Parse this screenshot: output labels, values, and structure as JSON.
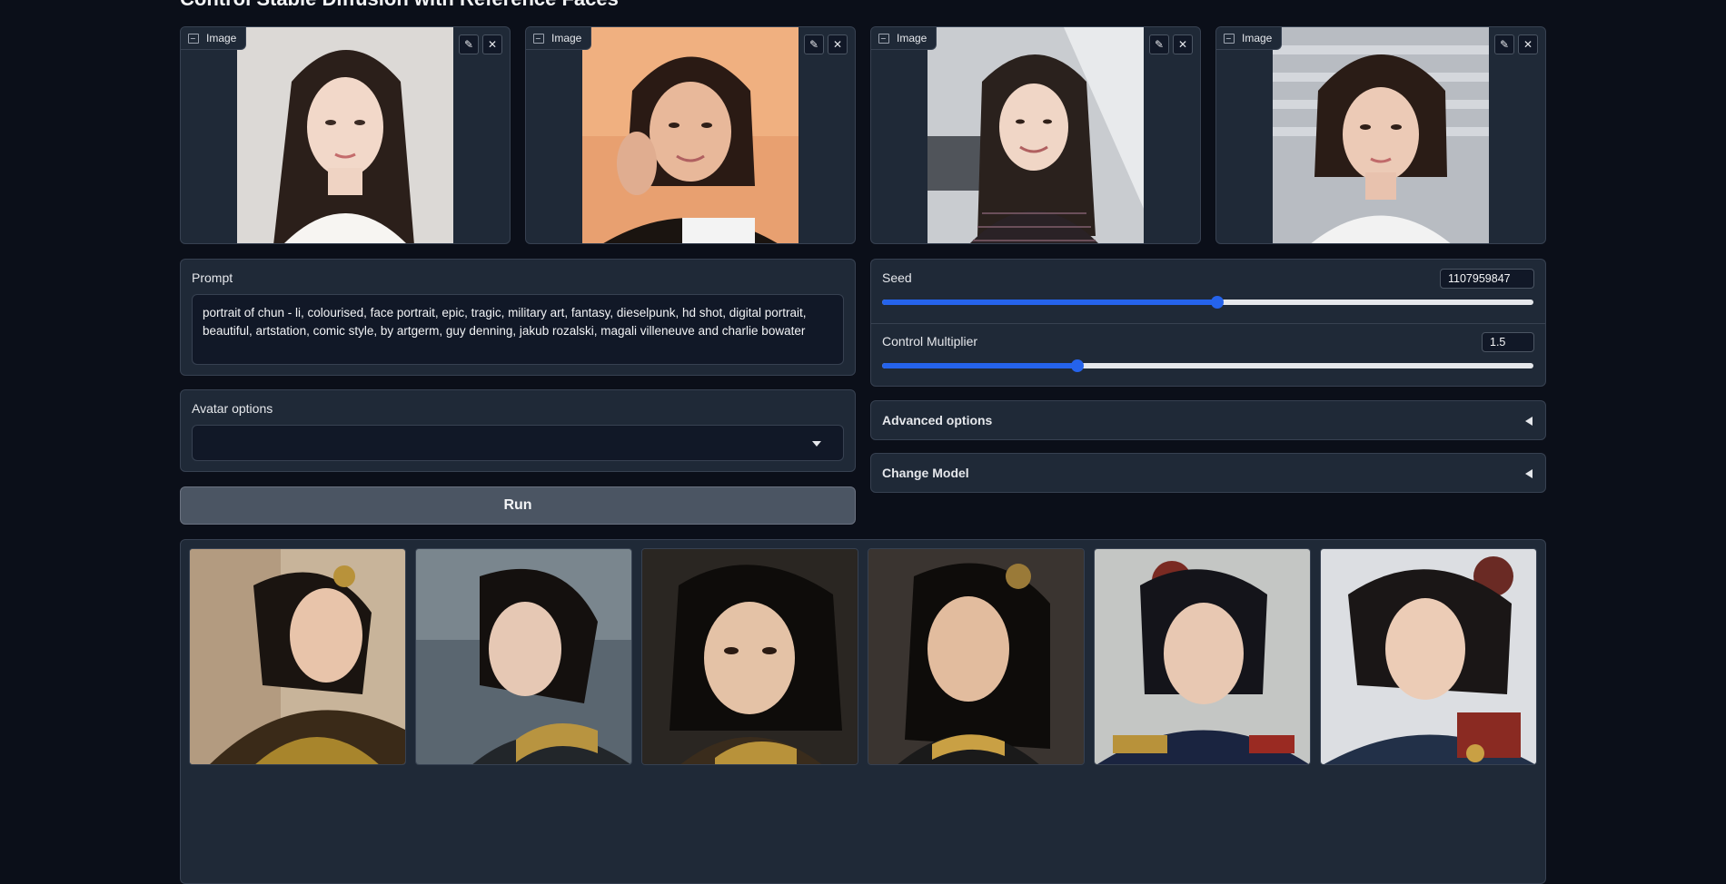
{
  "page": {
    "title": "Control Stable Diffusion with Reference Faces"
  },
  "input_images": [
    {
      "label": "Image",
      "edit_icon": "pencil-icon",
      "close_icon": "close-icon"
    },
    {
      "label": "Image",
      "edit_icon": "pencil-icon",
      "close_icon": "close-icon"
    },
    {
      "label": "Image",
      "edit_icon": "pencil-icon",
      "close_icon": "close-icon"
    },
    {
      "label": "Image",
      "edit_icon": "pencil-icon",
      "close_icon": "close-icon"
    }
  ],
  "prompt": {
    "label": "Prompt",
    "value": "portrait of chun - li, colourised, face portrait, epic, tragic, military art, fantasy, dieselpunk, hd shot, digital portrait, beautiful, artstation, comic style, by artgerm, guy denning, jakub rozalski, magali villeneuve and charlie bowater"
  },
  "avatar_options": {
    "label": "Avatar options",
    "value": ""
  },
  "run_button": {
    "label": "Run"
  },
  "seed": {
    "label": "Seed",
    "value": "1107959847",
    "slider_fraction": 0.515
  },
  "control_multiplier": {
    "label": "Control Multiplier",
    "value": "1.5",
    "slider_fraction": 0.3
  },
  "advanced_options": {
    "label": "Advanced options"
  },
  "change_model": {
    "label": "Change Model"
  },
  "gallery": {
    "count": 6
  },
  "colors": {
    "background": "#0b0f19",
    "panel": "#1f2937",
    "accent": "#2563eb",
    "button": "#4b5563"
  }
}
